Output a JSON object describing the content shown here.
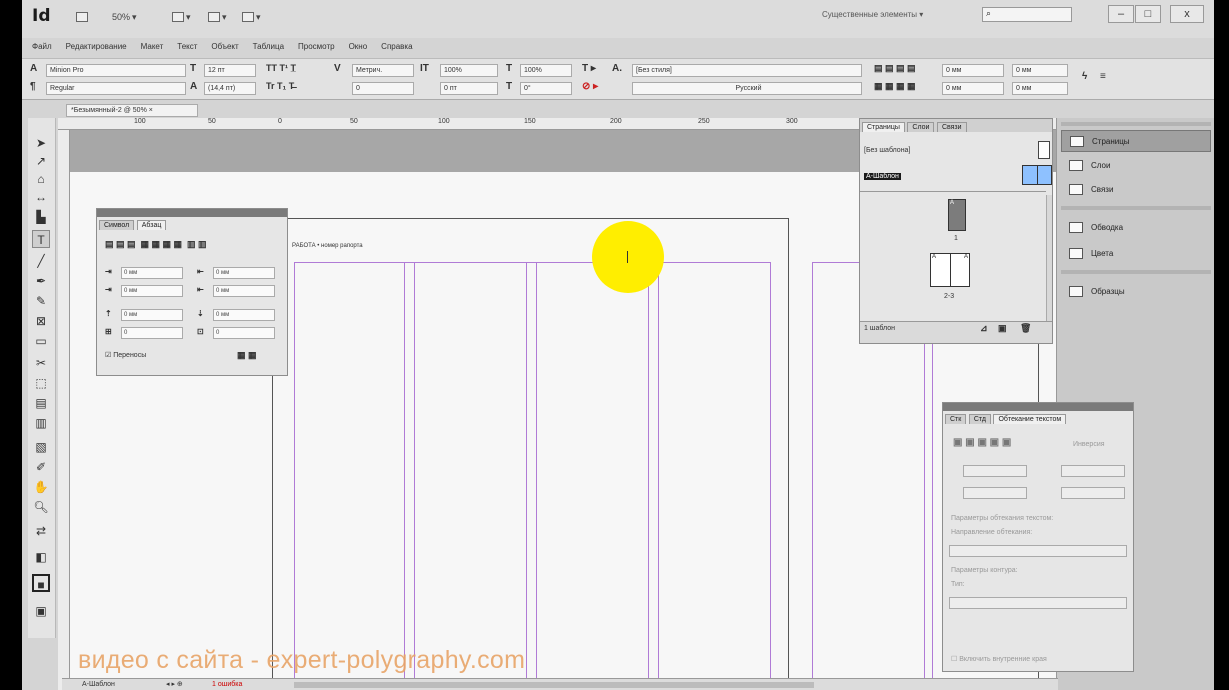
{
  "app": {
    "logo": "Id",
    "zoom": "50%",
    "workspace": "Существенные элементы"
  },
  "window_controls": {
    "minimize": "–",
    "maximize": "□",
    "close": "x"
  },
  "menu": [
    "Файл",
    "Редактирование",
    "Макет",
    "Текст",
    "Объект",
    "Таблица",
    "Просмотр",
    "Окно",
    "Справка"
  ],
  "control_panel": {
    "font_family": "Minion Pro",
    "font_style": "Regular",
    "font_size": "12 пт",
    "leading": "(14,4 пт)",
    "tracking_method": "Метрич.",
    "vertical_scale": "100%",
    "horizontal_scale": "100%",
    "baseline_shift": "0 пт",
    "skew": "0°",
    "kerning": "0",
    "char_style": "[Без стиля]",
    "language": "Русский",
    "indent_left": "0 мм",
    "indent_right": "0 мм",
    "space_before": "0 мм",
    "space_after": "0 мм"
  },
  "document_tab": "*Безымянный-2 @ 50%",
  "ruler_marks": [
    "100",
    "50",
    "0",
    "50",
    "100",
    "150",
    "200",
    "250",
    "300"
  ],
  "header_text": "РАБОТА • номер рапорта",
  "paragraph_panel": {
    "tabs": [
      "Символ",
      "Абзац"
    ],
    "fields": [
      "0 мм",
      "0 мм",
      "0 мм",
      "0 мм",
      "0 мм",
      "0 мм",
      "0",
      "0"
    ],
    "hyphenation_label": "Переносы"
  },
  "pages_panel": {
    "tabs": [
      "Страницы",
      "Слои",
      "Связи"
    ],
    "none_master": "[Без шаблона]",
    "master_a": "A-Шаблон",
    "page1_label": "1",
    "spread_label": "2-3",
    "master_letter": "A",
    "footer": "1 шаблон"
  },
  "text_wrap_panel": {
    "tabs": [
      "Стк",
      "Стд",
      "Обтекание текстом"
    ],
    "invert_label": "Инверсия",
    "params_label": "Параметры обтекания текстом:",
    "direction_label": "Направление обтекания:",
    "contour_label": "Параметры контура:",
    "type_label": "Тип:",
    "inner_edge_label": "Включить внутренние края"
  },
  "dock": [
    {
      "label": "Страницы",
      "icon": "pages-icon"
    },
    {
      "label": "Слои",
      "icon": "layers-icon"
    },
    {
      "label": "Связи",
      "icon": "links-icon"
    },
    {
      "label": "Обводка",
      "icon": "stroke-icon"
    },
    {
      "label": "Цвета",
      "icon": "swatches-icon"
    },
    {
      "label": "Образцы",
      "icon": "samples-icon"
    }
  ],
  "status_bar": {
    "master": "А-Шаблон",
    "errors": "1 ошибка"
  },
  "watermark": "видео с сайта - expert-polygraphy.com"
}
